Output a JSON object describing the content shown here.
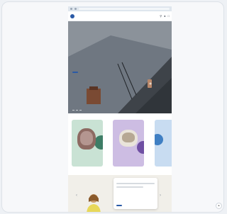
{
  "site": {
    "logo_text": "",
    "nav_items": [
      "",
      "",
      "",
      "",
      "",
      ""
    ],
    "icons": [
      "search-icon",
      "account-icon",
      "cart-icon"
    ]
  },
  "hero": {
    "kicker": "",
    "title": "",
    "button_label": ""
  },
  "products_section": {
    "title": "",
    "link_label": ""
  },
  "promo": {
    "title": "",
    "popup_title": "",
    "popup_button_label": ""
  },
  "colors": {
    "brand_blue": "#2a5aa6",
    "hero_grey": "#6f7781",
    "product_green": "#c9e2d4",
    "product_lilac": "#cdbde3",
    "product_blue": "#c8dcf1"
  }
}
